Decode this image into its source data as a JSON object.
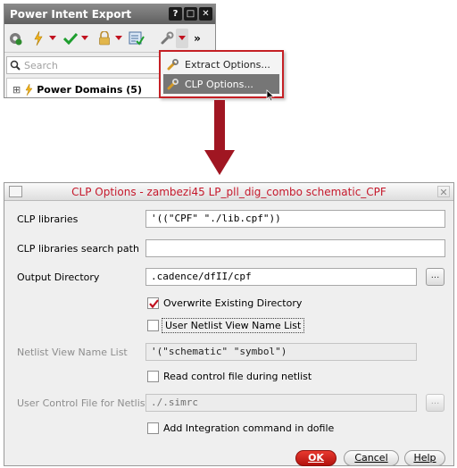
{
  "panel": {
    "title": "Power Intent Export",
    "window_buttons": [
      "?",
      "□",
      "✕"
    ],
    "toolbar_more": "»",
    "search_placeholder": "Search",
    "tree_item": "Power Domains (5)",
    "tree_expander": "⊞"
  },
  "menu": {
    "items": [
      {
        "label": "Extract Options...",
        "icon": "wrench-icon",
        "selected": false
      },
      {
        "label": "CLP Options...",
        "icon": "wrench-icon",
        "selected": true
      }
    ]
  },
  "dialog": {
    "title": "CLP Options - zambezi45 LP_pll_dig_combo schematic_CPF",
    "close_glyph": "✕",
    "fields": {
      "clp_libraries_label": "CLP libraries",
      "clp_libraries_value": "'((\"CPF\" \"./lib.cpf\"))",
      "search_path_label": "CLP libraries search path",
      "search_path_value": "",
      "output_dir_label": "Output Directory",
      "output_dir_value": ".cadence/dfII/cpf",
      "netlist_view_label": "Netlist View Name List",
      "netlist_view_value": "'(\"schematic\" \"symbol\")",
      "user_control_label": "User Control File for Netlist",
      "user_control_value": "./.simrc",
      "browse_label": "..."
    },
    "checkboxes": {
      "overwrite": {
        "label": "Overwrite Existing Directory",
        "checked": true
      },
      "user_netlist": {
        "label": "User Netlist View Name List",
        "checked": false
      },
      "read_control": {
        "label": "Read control file during netlist",
        "checked": false
      },
      "add_integration": {
        "label": "Add Integration command in dofile",
        "checked": false
      }
    },
    "buttons": {
      "ok": "OK",
      "cancel": "Cancel",
      "help": "Help"
    }
  },
  "colors": {
    "accent_red": "#c5182b",
    "ok_button": "#d0251d",
    "menu_selected": "#767676"
  }
}
